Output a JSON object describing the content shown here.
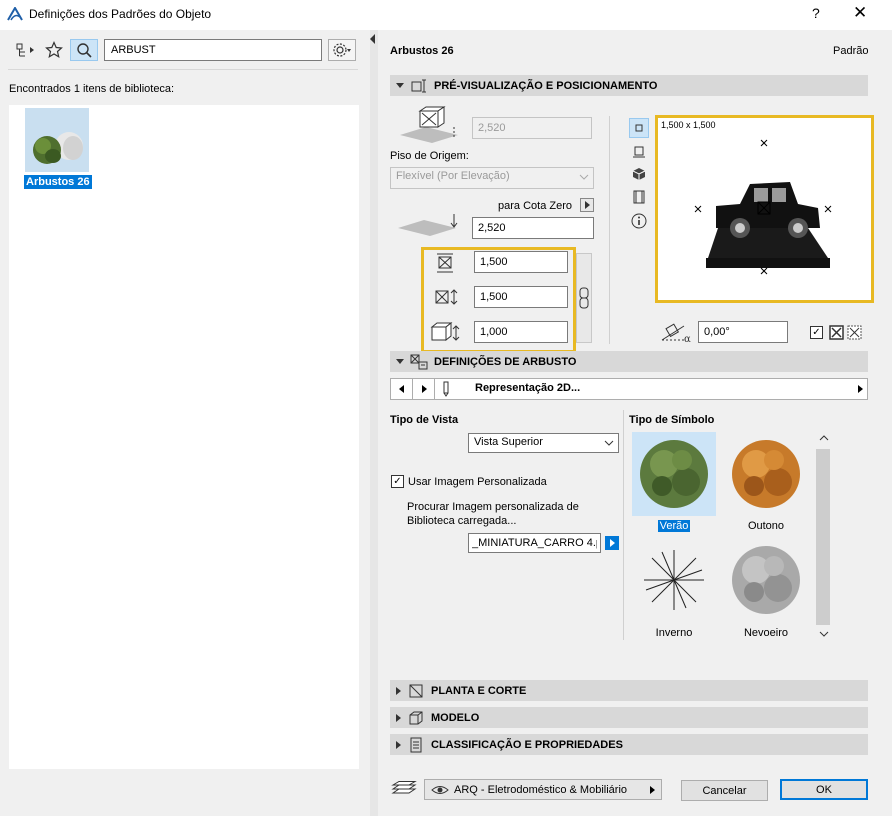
{
  "window": {
    "title": "Definições dos Padrões do Objeto",
    "help": "?",
    "close": "✕"
  },
  "left": {
    "search_value": "ARBUST",
    "found_text": "Encontrados 1 itens de biblioteca:",
    "items": [
      {
        "label": "Arbustos 26"
      }
    ]
  },
  "right": {
    "object_name": "Arbustos 26",
    "default_label": "Padrão",
    "sections": {
      "preview": "PRÉ-VISUALIZAÇÃO E POSICIONAMENTO",
      "shrub": "DEFINIÇÕES DE ARBUSTO",
      "plan": "PLANTA E CORTE",
      "model": "MODELO",
      "classification": "CLASSIFICAÇÃO E PROPRIEDADES"
    },
    "positioning": {
      "elevation_value": "2,520",
      "origin_floor_label": "Piso de Origem:",
      "origin_floor_value": "Flexível (Por Elevação)",
      "to_zero_label": "para Cota Zero",
      "to_zero_value": "2,520",
      "width": "1,500",
      "depth": "1,500",
      "height": "1,000",
      "preview_size": "1,500 x 1,500",
      "angle": "0,00°"
    },
    "shrub": {
      "representation": "Representação 2D...",
      "view_type_label": "Tipo de Vista",
      "view_type_value": "Vista Superior",
      "custom_image_label": "Usar Imagem Personalizada",
      "custom_image_checked": "✓",
      "browse_label_1": "Procurar Imagem personalizada de",
      "browse_label_2": "Biblioteca carregada...",
      "image_file": "_MINIATURA_CARRO 4.p",
      "symbol_type_label": "Tipo de Símbolo",
      "symbols": [
        {
          "label": "Verão",
          "selected": true
        },
        {
          "label": "Outono",
          "selected": false
        },
        {
          "label": "Inverno",
          "selected": false
        },
        {
          "label": "Nevoeiro",
          "selected": false
        }
      ]
    },
    "footer": {
      "layer": "ARQ - Eletrodoméstico & Mobiliário",
      "cancel": "Cancelar",
      "ok": "OK"
    }
  },
  "colors": {
    "highlight": "#e8b923",
    "selection": "#0078d7",
    "section_bg": "#d8d8d8"
  }
}
